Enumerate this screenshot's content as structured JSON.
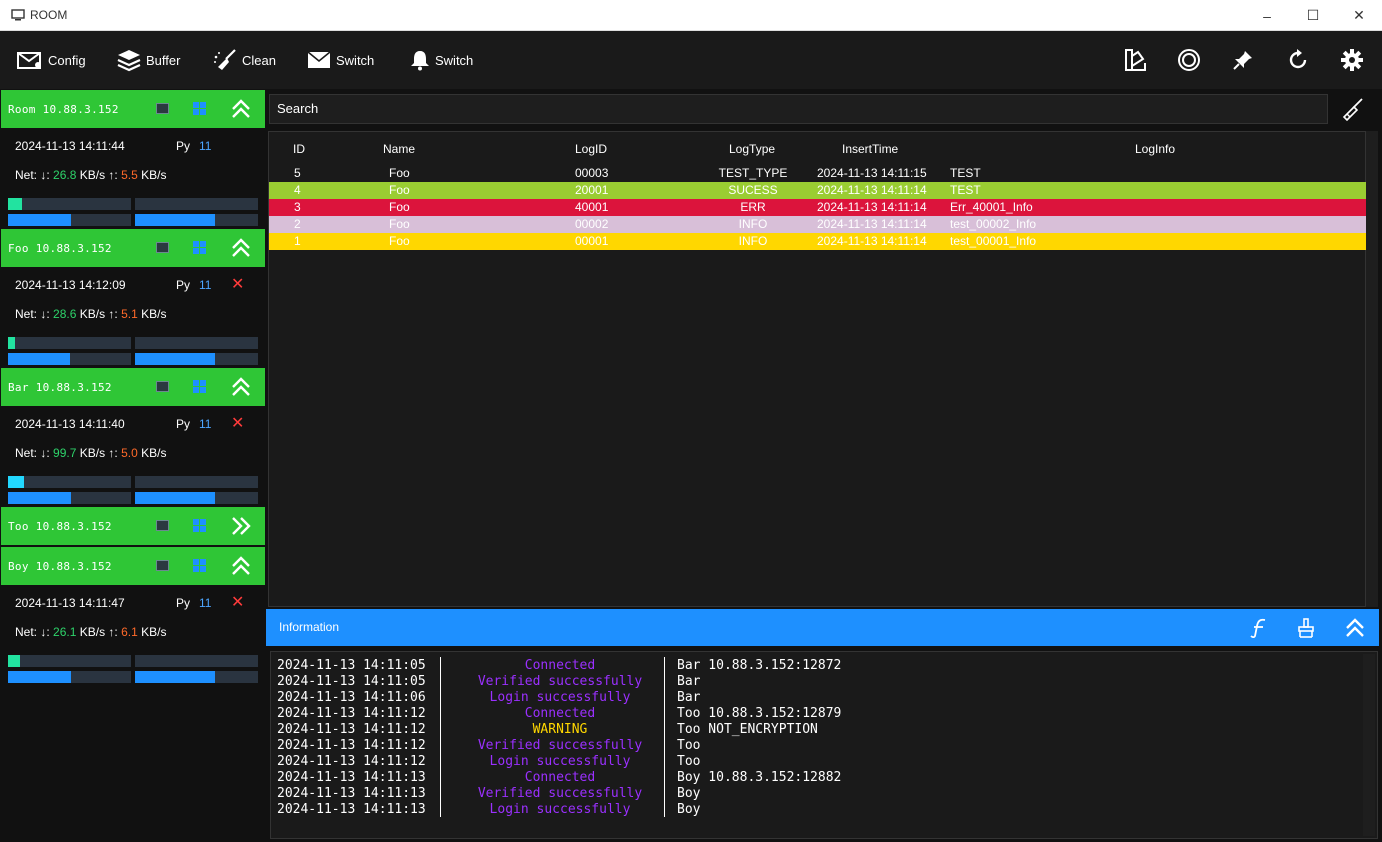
{
  "window": {
    "title": "ROOM",
    "minimize": "–",
    "maximize": "☐",
    "close": "✕"
  },
  "toolbar": {
    "config_label": "Config",
    "buffer_label": "Buffer",
    "clean_label": "Clean",
    "switch1_label": "Switch",
    "switch2_label": "Switch"
  },
  "colors": {
    "header_green": "#2fc636",
    "info_blue": "#1e90ff",
    "row_green": "#9acd32",
    "row_red": "#dc143c",
    "row_lavender": "#d8bfd8",
    "row_gold": "#ffd700",
    "status_purple": "#9b30ff",
    "warning_yellow": "#ffd700",
    "down_green": "#2ed36a",
    "up_orange": "#ff6a2a"
  },
  "sessions": [
    {
      "header": "Room 10.88.3.152",
      "expanded": true,
      "date": "2024-11-13 14:11:44",
      "py_label": "Py",
      "py_value": "11",
      "net_label": "Net: ↓:",
      "down": "26.8",
      "down_unit": "KB/s ↑:",
      "up": "5.5",
      "up_unit": "KB/s",
      "has_close": false,
      "bar1": 0.11,
      "bar2": 0,
      "bar3": 0.51,
      "bar4": 0.65,
      "bar1_color": "#22e3a0"
    },
    {
      "header": "Foo 10.88.3.152",
      "expanded": true,
      "date": "2024-11-13 14:12:09",
      "py_label": "Py",
      "py_value": "11",
      "net_label": "Net: ↓:",
      "down": "28.6",
      "down_unit": "KB/s ↑:",
      "up": "5.1",
      "up_unit": "KB/s",
      "has_close": true,
      "close": "✕",
      "bar1": 0.06,
      "bar2": 0,
      "bar3": 0.5,
      "bar4": 0.65,
      "bar1_color": "#22e3a0"
    },
    {
      "header": "Bar 10.88.3.152",
      "expanded": true,
      "date": "2024-11-13 14:11:40",
      "py_label": "Py",
      "py_value": "11",
      "net_label": "Net: ↓:",
      "down": "99.7",
      "down_unit": "KB/s ↑:",
      "up": "5.0",
      "up_unit": "KB/s",
      "has_close": true,
      "close": "✕",
      "bar1": 0.13,
      "bar2": 0,
      "bar3": 0.51,
      "bar4": 0.65,
      "bar1_color": "#22d8ff"
    },
    {
      "header": "Too 10.88.3.152",
      "expanded": false
    },
    {
      "header": "Boy 10.88.3.152",
      "expanded": true,
      "date": "2024-11-13 14:11:47",
      "py_label": "Py",
      "py_value": "11",
      "net_label": "Net: ↓:",
      "down": "26.1",
      "down_unit": "KB/s ↑:",
      "up": "6.1",
      "up_unit": "KB/s",
      "has_close": true,
      "close": "✕",
      "bar1": 0.1,
      "bar2": 0,
      "bar3": 0.51,
      "bar4": 0.65,
      "bar1_color": "#22e3a0"
    }
  ],
  "search": {
    "placeholder": "Search"
  },
  "grid": {
    "columns": [
      "ID",
      "Name",
      "LogID",
      "LogType",
      "InsertTime",
      "LogInfo"
    ],
    "rows": [
      {
        "id": "5",
        "name": "Foo",
        "logid": "00003",
        "type": "TEST_TYPE",
        "time": "2024-11-13 14:11:15",
        "info": "TEST",
        "bg": "transparent",
        "fg": "#ffffff"
      },
      {
        "id": "4",
        "name": "Foo",
        "logid": "20001",
        "type": "SUCESS",
        "time": "2024-11-13 14:11:14",
        "info": "TEST",
        "bg": "#9acd32",
        "fg": "#ffffff"
      },
      {
        "id": "3",
        "name": "Foo",
        "logid": "40001",
        "type": "ERR",
        "time": "2024-11-13 14:11:14",
        "info": "Err_40001_Info",
        "bg": "#dc143c",
        "fg": "#ffffff"
      },
      {
        "id": "2",
        "name": "Foo",
        "logid": "00002",
        "type": "INFO",
        "time": "2024-11-13 14:11:14",
        "info": "test_00002_Info",
        "bg": "#d8bfd8",
        "fg": "#ffffff"
      },
      {
        "id": "1",
        "name": "Foo",
        "logid": "00001",
        "type": "INFO",
        "time": "2024-11-13 14:11:14",
        "info": "test_00001_Info",
        "bg": "#ffd700",
        "fg": "#ffffff"
      }
    ]
  },
  "info": {
    "title": "Information",
    "lines": [
      {
        "time": "2024-11-13 14:11:05",
        "status": "Connected",
        "msg": "Bar 10.88.3.152:12872",
        "warn": false
      },
      {
        "time": "2024-11-13 14:11:05",
        "status": "Verified successfully",
        "msg": "Bar",
        "warn": false
      },
      {
        "time": "2024-11-13 14:11:06",
        "status": "Login successfully",
        "msg": "Bar",
        "warn": false
      },
      {
        "time": "2024-11-13 14:11:12",
        "status": "Connected",
        "msg": "Too 10.88.3.152:12879",
        "warn": false
      },
      {
        "time": "2024-11-13 14:11:12",
        "status": "WARNING",
        "msg": "Too NOT_ENCRYPTION",
        "warn": true
      },
      {
        "time": "2024-11-13 14:11:12",
        "status": "Verified successfully",
        "msg": "Too",
        "warn": false
      },
      {
        "time": "2024-11-13 14:11:12",
        "status": "Login successfully",
        "msg": "Too",
        "warn": false
      },
      {
        "time": "2024-11-13 14:11:13",
        "status": "Connected",
        "msg": "Boy 10.88.3.152:12882",
        "warn": false
      },
      {
        "time": "2024-11-13 14:11:13",
        "status": "Verified successfully",
        "msg": "Boy",
        "warn": false
      },
      {
        "time": "2024-11-13 14:11:13",
        "status": "Login successfully",
        "msg": "Boy",
        "warn": false
      }
    ]
  }
}
